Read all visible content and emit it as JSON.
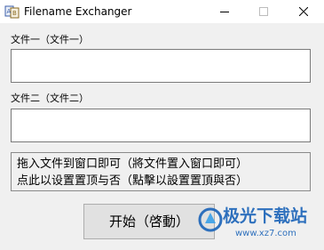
{
  "window": {
    "title": "Filename Exchanger"
  },
  "fields": {
    "first_label": "文件一（文件一）",
    "first_value": "",
    "second_label": "文件二（文件二）",
    "second_value": ""
  },
  "hint": {
    "line1": "拖入文件到窗口即可（將文件置入窗口即可）",
    "line2": "点此以设置置顶与否（點擊以設置置頂與否）"
  },
  "actions": {
    "start_label": "开始（啓動）"
  },
  "watermark": {
    "brand": "极光下载站",
    "url": "www.xz7.com"
  },
  "colors": {
    "watermark_blue": "#1a63b8"
  }
}
